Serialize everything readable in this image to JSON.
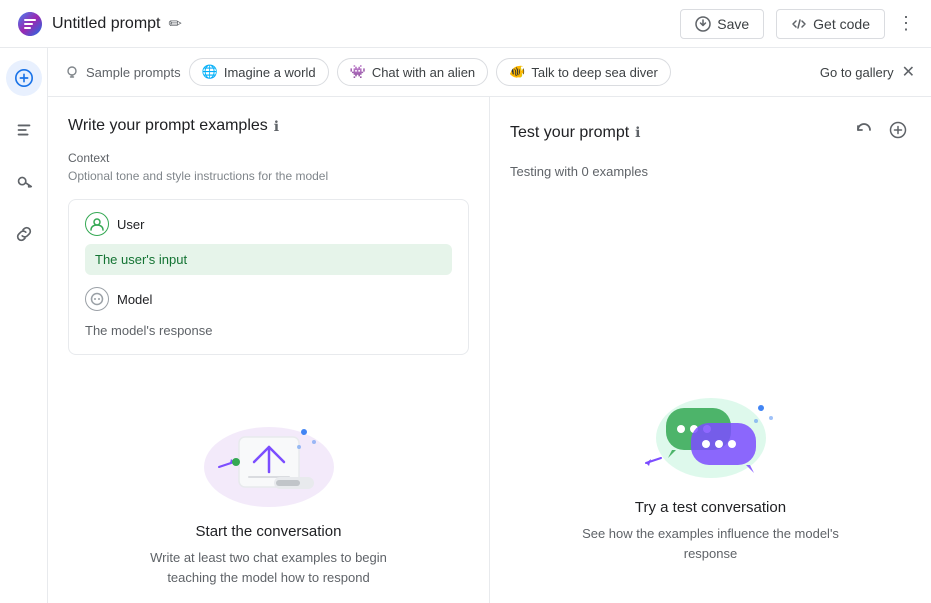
{
  "header": {
    "title": "Untitled prompt",
    "edit_icon": "✏",
    "save_label": "Save",
    "getcode_label": "Get code",
    "more_icon": "⋮"
  },
  "sidebar": {
    "items": [
      {
        "name": "add-icon",
        "icon": "＋",
        "active": true
      },
      {
        "name": "history-icon",
        "icon": "☰",
        "active": false
      },
      {
        "name": "key-icon",
        "icon": "🔑",
        "active": false
      },
      {
        "name": "link-icon",
        "icon": "🔗",
        "active": false
      }
    ]
  },
  "prompt_bar": {
    "label": "Sample prompts",
    "chips": [
      {
        "id": "imagine",
        "icon": "🌐",
        "label": "Imagine a world"
      },
      {
        "id": "alien",
        "icon": "👾",
        "label": "Chat with an alien"
      },
      {
        "id": "diver",
        "icon": "🐠",
        "label": "Talk to deep sea diver"
      }
    ],
    "gallery_label": "Go to gallery",
    "close_icon": "✕"
  },
  "left_panel": {
    "title": "Write your prompt examples",
    "info_icon": "ℹ",
    "context_label": "Context",
    "context_hint": "Optional tone and style instructions for the model",
    "user_label": "User",
    "user_input": "The user's input",
    "model_label": "Model",
    "model_response": "The model's response",
    "illustration": {
      "title": "Start the conversation",
      "description": "Write at least two chat examples to begin teaching the model how to respond"
    }
  },
  "right_panel": {
    "title": "Test your prompt",
    "info_icon": "ℹ",
    "refresh_icon": "↻",
    "add_icon": "⊕",
    "testing_label": "Testing with 0 examples",
    "illustration": {
      "title": "Try a test conversation",
      "description": "See how the examples influence the model's response"
    }
  }
}
